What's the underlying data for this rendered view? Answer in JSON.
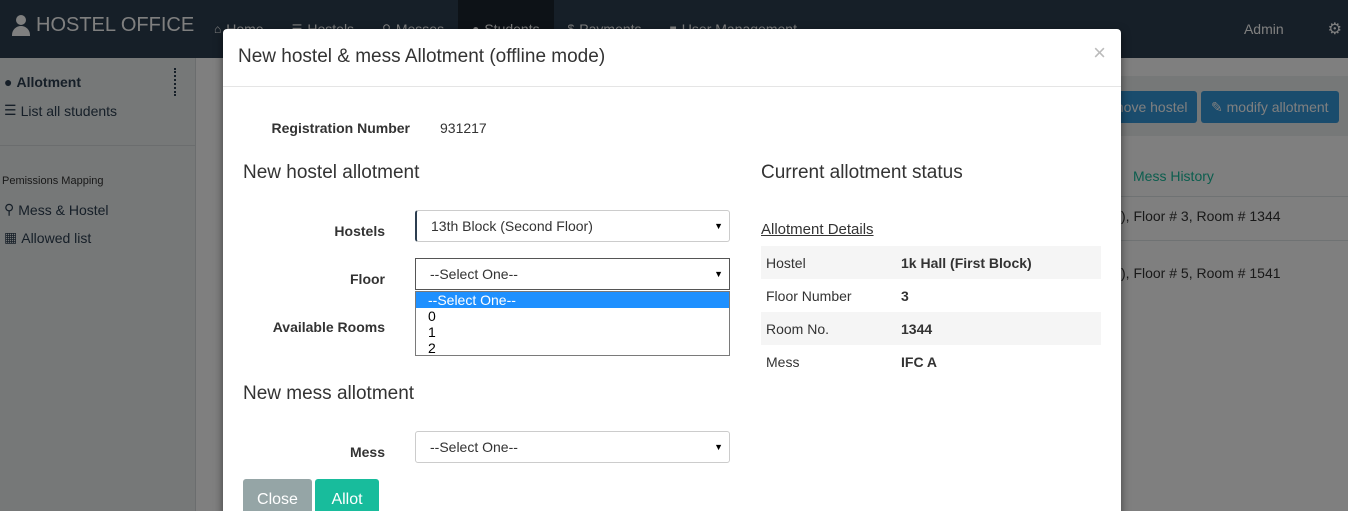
{
  "navbar": {
    "brand": "HOSTEL OFFICE",
    "items": [
      {
        "label": "Home",
        "icon": "home-icon",
        "glyph": "⌂"
      },
      {
        "label": "Hostels",
        "icon": "list-icon",
        "glyph": "☰"
      },
      {
        "label": "Messes",
        "icon": "cutlery-icon",
        "glyph": "⚲"
      },
      {
        "label": "Students",
        "icon": "user-icon",
        "glyph": "●"
      },
      {
        "label": "Payments",
        "icon": "dollar-icon",
        "glyph": "$"
      },
      {
        "label": "User Management",
        "icon": "lock-icon",
        "glyph": "■"
      }
    ],
    "admin": "Admin",
    "gear_glyph": "⚙"
  },
  "sidebar": {
    "allotment": "Allotment",
    "list_students": "List all students",
    "permissions_heading": "Pemissions Mapping",
    "mess_hostel": "Mess & Hostel",
    "allowed_list": "Allowed list"
  },
  "background": {
    "remove_hostel": "move hostel",
    "modify_allotment": "modify allotment",
    "mess_history": "Mess History",
    "row1": "), Floor # 3, Room # 1344",
    "row2": "), Floor # 5, Room # 1541"
  },
  "modal": {
    "title": "New hostel & mess Allotment (offline mode)",
    "close_glyph": "×",
    "registration_label": "Registration Number",
    "registration_value": "931217",
    "new_hostel_heading": "New hostel allotment",
    "hostels_label": "Hostels",
    "hostels_value": "13th Block (Second Floor)",
    "floor_label": "Floor",
    "floor_value": "--Select One--",
    "floor_options": [
      "--Select One--",
      "0",
      "1",
      "2"
    ],
    "rooms_label": "Available Rooms",
    "new_mess_heading": "New mess allotment",
    "mess_label": "Mess",
    "mess_value": "--Select One--",
    "close_button": "Close",
    "allot_button": "Allot",
    "status_heading": "Current allotment status",
    "details_link": "Allotment Details",
    "details": [
      {
        "key": "Hostel",
        "value": "1k Hall (First Block)"
      },
      {
        "key": "Floor Number",
        "value": "3"
      },
      {
        "key": "Room No.",
        "value": "1344"
      },
      {
        "key": "Mess",
        "value": "IFC A"
      }
    ]
  },
  "colors": {
    "navbar": "#2c3e50",
    "primary": "#3498db",
    "success": "#18bc9c",
    "default_button": "#95a5a6",
    "dropdown_selected": "#1e90ff"
  }
}
